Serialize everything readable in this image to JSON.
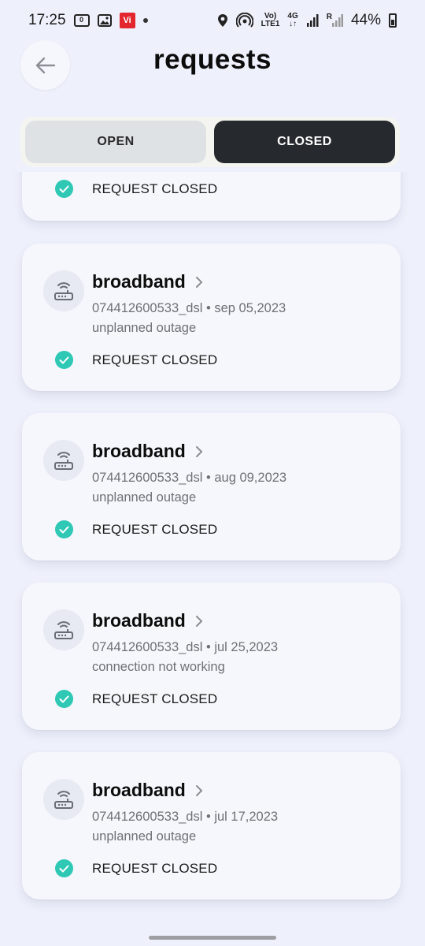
{
  "status_bar": {
    "time": "17:25",
    "carrier_badge": "Vi",
    "box_icon_text": "0",
    "volte_line1": "Vo)",
    "volte_line2": "LTE1",
    "net_type": "4G",
    "roaming": "R",
    "battery_percent": "44%",
    "icons": [
      "sim-icon",
      "image-icon",
      "vi-carrier-icon",
      "notification-dot-icon",
      "location-icon",
      "hotspot-icon",
      "volte-icon",
      "signal-icon",
      "battery-icon"
    ]
  },
  "header": {
    "title": "requests",
    "back_icon": "arrow-left-icon"
  },
  "tabs": [
    {
      "label": "OPEN",
      "active": false
    },
    {
      "label": "CLOSED",
      "active": true
    }
  ],
  "requests": [
    {
      "status": "REQUEST CLOSED"
    },
    {
      "service": "broadband",
      "account": "074412600533_dsl",
      "date": "sep 05,2023",
      "issue": "unplanned outage",
      "status": "REQUEST CLOSED"
    },
    {
      "service": "broadband",
      "account": "074412600533_dsl",
      "date": "aug 09,2023",
      "issue": "unplanned outage",
      "status": "REQUEST CLOSED"
    },
    {
      "service": "broadband",
      "account": "074412600533_dsl",
      "date": "jul 25,2023",
      "issue": "connection not working",
      "status": "REQUEST CLOSED"
    },
    {
      "service": "broadband",
      "account": "074412600533_dsl",
      "date": "jul 17,2023",
      "issue": "unplanned outage",
      "status": "REQUEST CLOSED"
    }
  ],
  "colors": {
    "background": "#eef0fb",
    "card": "#f6f7fc",
    "active_tab": "#26292d",
    "inactive_tab": "#dfe2e5",
    "check": "#2ec8b5"
  }
}
